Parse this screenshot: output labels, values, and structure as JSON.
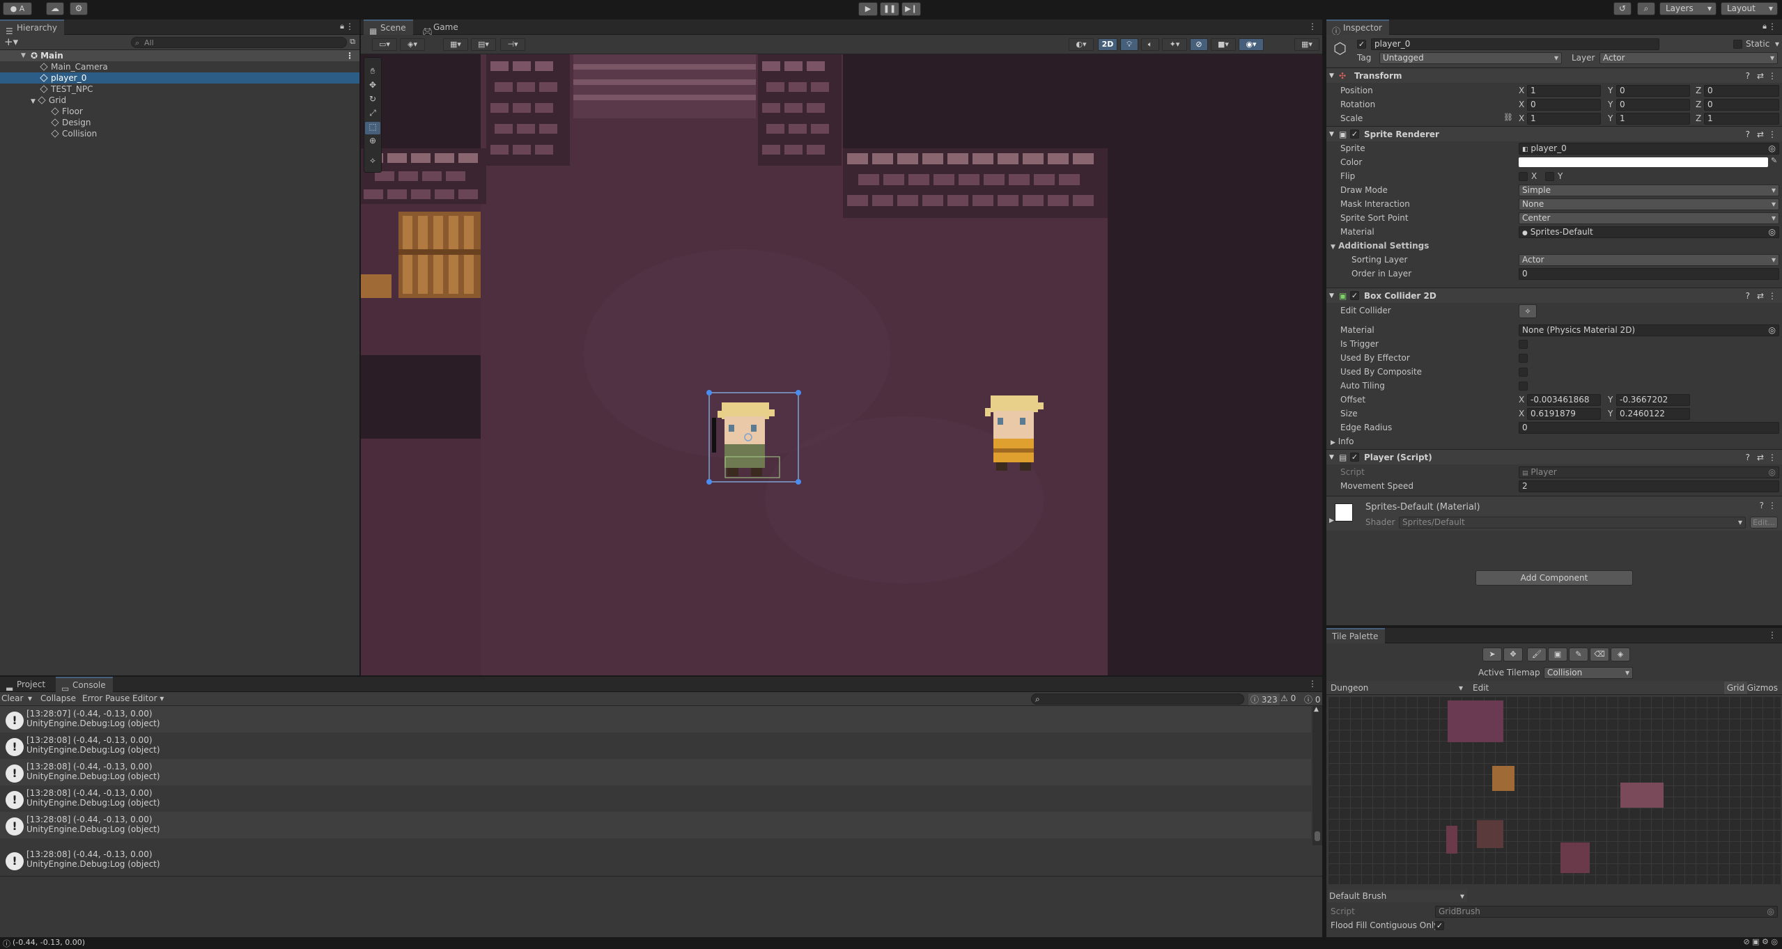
{
  "toolbar": {
    "account_label": "A",
    "layers_label": "Layers",
    "layout_label": "Layout",
    "play_icon": "play-icon",
    "pause_icon": "pause-icon",
    "step_icon": "step-icon"
  },
  "hierarchy": {
    "tab_label": "Hierarchy",
    "search_placeholder": "All",
    "items": [
      {
        "label": "Main",
        "depth": 0
      },
      {
        "label": "Main_Camera",
        "depth": 1
      },
      {
        "label": "player_0",
        "depth": 1
      },
      {
        "label": "TEST_NPC",
        "depth": 1
      },
      {
        "label": "Grid",
        "depth": 1
      },
      {
        "label": "Floor",
        "depth": 2
      },
      {
        "label": "Design",
        "depth": 2
      },
      {
        "label": "Collision",
        "depth": 2
      }
    ]
  },
  "scene": {
    "tabs": [
      "Scene",
      "Game"
    ],
    "mode_2d_label": "2D"
  },
  "inspector": {
    "tab_label": "Inspector",
    "object_name": "player_0",
    "static_label": "Static",
    "tag_label": "Tag",
    "tag_value": "Untagged",
    "layer_label": "Layer",
    "layer_value": "Actor",
    "transform": {
      "title": "Transform",
      "position_label": "Position",
      "rotation_label": "Rotation",
      "scale_label": "Scale",
      "position": {
        "x": "1",
        "y": "0",
        "z": "0"
      },
      "rotation": {
        "x": "0",
        "y": "0",
        "z": "0"
      },
      "scale": {
        "x": "1",
        "y": "1",
        "z": "1"
      }
    },
    "sprite_renderer": {
      "title": "Sprite Renderer",
      "sprite_label": "Sprite",
      "sprite_value": "player_0",
      "color_label": "Color",
      "flip_label": "Flip",
      "flip_x": "X",
      "flip_y": "Y",
      "draw_mode_label": "Draw Mode",
      "draw_mode_value": "Simple",
      "mask_label": "Mask Interaction",
      "mask_value": "None",
      "sort_point_label": "Sprite Sort Point",
      "sort_point_value": "Center",
      "material_label": "Material",
      "material_value": "Sprites-Default",
      "additional_label": "Additional Settings",
      "sorting_layer_label": "Sorting Layer",
      "sorting_layer_value": "Actor",
      "order_label": "Order in Layer",
      "order_value": "0"
    },
    "box_collider": {
      "title": "Box Collider 2D",
      "edit_label": "Edit Collider",
      "material_label": "Material",
      "material_value": "None (Physics Material 2D)",
      "trigger_label": "Is Trigger",
      "effector_label": "Used By Effector",
      "composite_label": "Used By Composite",
      "autotiling_label": "Auto Tiling",
      "offset_label": "Offset",
      "offset_x": "-0.003461868",
      "offset_y": "-0.3667202",
      "size_label": "Size",
      "size_x": "0.6191879",
      "size_y": "0.2460122",
      "edge_label": "Edge Radius",
      "edge_value": "0",
      "info_label": "Info"
    },
    "player_script": {
      "title": "Player (Script)",
      "script_label": "Script",
      "script_value": "Player",
      "speed_label": "Movement Speed",
      "speed_value": "2"
    },
    "material": {
      "title": "Sprites-Default (Material)",
      "shader_label": "Shader",
      "shader_value": "Sprites/Default",
      "edit_label": "Edit..."
    },
    "add_component": "Add Component"
  },
  "tile_palette": {
    "tab_label": "Tile Palette",
    "active_tilemap_label": "Active Tilemap",
    "active_tilemap_value": "Collision",
    "palette_value": "Dungeon",
    "edit_label": "Edit",
    "grid_label": "Grid",
    "gizmos_label": "Gizmos",
    "brush_value": "Default Brush",
    "script_label": "Script",
    "script_value": "GridBrush",
    "flood_label": "Flood Fill Contiguous Only"
  },
  "console": {
    "tabs": [
      "Project",
      "Console"
    ],
    "clear_label": "Clear",
    "collapse_label": "Collapse",
    "error_pause_label": "Error Pause",
    "editor_label": "Editor",
    "count_info": "323",
    "count_warn": "0",
    "count_error": "0",
    "entries": [
      {
        "line1": "[13:28:07] (-0.44, -0.13, 0.00)",
        "line2": "UnityEngine.Debug:Log (object)"
      },
      {
        "line1": "[13:28:08] (-0.44, -0.13, 0.00)",
        "line2": "UnityEngine.Debug:Log (object)"
      },
      {
        "line1": "[13:28:08] (-0.44, -0.13, 0.00)",
        "line2": "UnityEngine.Debug:Log (object)"
      },
      {
        "line1": "[13:28:08] (-0.44, -0.13, 0.00)",
        "line2": "UnityEngine.Debug:Log (object)"
      },
      {
        "line1": "[13:28:08] (-0.44, -0.13, 0.00)",
        "line2": "UnityEngine.Debug:Log (object)"
      },
      {
        "line1": "[13:28:08] (-0.44, -0.13, 0.00)",
        "line2": "UnityEngine.Debug:Log (object)"
      }
    ]
  },
  "status_bar": {
    "message": "(-0.44, -0.13, 0.00)"
  }
}
